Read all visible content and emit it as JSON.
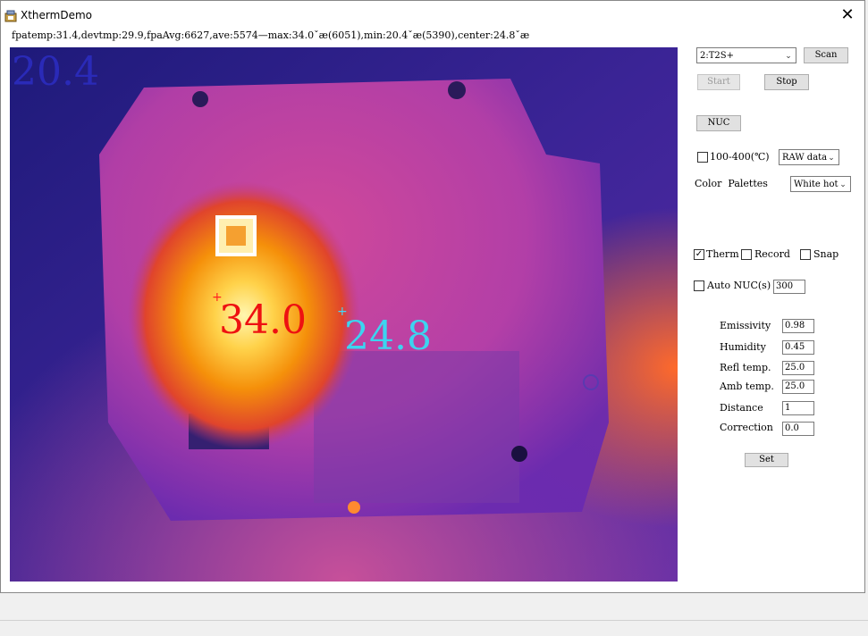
{
  "window": {
    "title": "XthermDemo"
  },
  "status_line": "fpatemp:31.4,devtmp:29.9,fpaAvg:6627,ave:5574—max:34.0ˇæ(6051),min:20.4ˇæ(5390),center:24.8ˇæ",
  "thermal": {
    "min_overlay": "20.4",
    "max_overlay": "34.0",
    "center_overlay": "24.8",
    "marker_plus": "+"
  },
  "controls": {
    "device_select": "2:T2S+",
    "scan_button": "Scan",
    "start_button": "Start",
    "stop_button": "Stop",
    "nuc_button": "NUC",
    "range_checkbox_label": "100-400(℃)",
    "data_select": "RAW data",
    "color_label": "Color  Palettes",
    "palette_select": "White hot",
    "therm_label": "Therm",
    "therm_checked": "✓",
    "record_label": "Record",
    "snap_label": "Snap",
    "auto_nuc_label": "Auto NUC(s)",
    "auto_nuc_value": "300",
    "emissivity_label": "Emissivity",
    "emissivity_value": "0.98",
    "humidity_label": "Humidity",
    "humidity_value": "0.45",
    "refl_label": "Refl temp.",
    "refl_value": "25.0",
    "amb_label": "Amb temp.",
    "amb_value": "25.0",
    "distance_label": "Distance",
    "distance_value": "1",
    "correction_label": "Correction",
    "correction_value": "0.0",
    "set_button": "Set"
  }
}
